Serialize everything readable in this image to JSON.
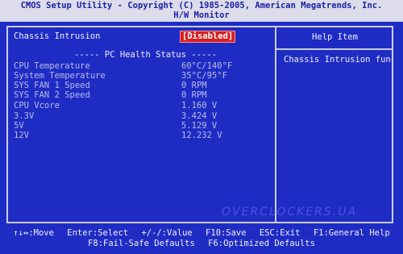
{
  "title": {
    "line1": "CMOS Setup Utility - Copyright (C) 1985-2005, American Megatrends, Inc.",
    "line2": "H/W Monitor"
  },
  "chassis": {
    "label": "Chassis Intrusion",
    "value": "[Disabled]"
  },
  "section_header": "----- PC Health Status -----",
  "readings": [
    {
      "label": "CPU Temperature",
      "value": "60°C/140°F"
    },
    {
      "label": "System Temperature",
      "value": "35°C/95°F"
    },
    {
      "label": "SYS FAN 1 Speed",
      "value": "0 RPM"
    },
    {
      "label": "SYS FAN 2 Speed",
      "value": "0 RPM"
    },
    {
      "label": "CPU Vcore",
      "value": "1.160 V"
    },
    {
      "label": "3.3V",
      "value": "3.424 V"
    },
    {
      "label": "5V",
      "value": "5.129 V"
    },
    {
      "label": "12V",
      "value": "12.232 V"
    }
  ],
  "help": {
    "title": "Help Item",
    "text": "Chassis Intrusion func"
  },
  "watermark": "OVERCLOCKERS.UA",
  "footer": {
    "line1": [
      "↑↓↔:Move",
      "Enter:Select",
      "+/-/:Value",
      "F10:Save",
      "ESC:Exit",
      "F1:General Help"
    ],
    "line2": [
      "F8:Fail-Safe Defaults",
      "F6:Optimized Defaults"
    ]
  },
  "colors": {
    "background": "#1f2cc4",
    "title_bar": "#dcdcea",
    "selected_value": "#d82020"
  }
}
